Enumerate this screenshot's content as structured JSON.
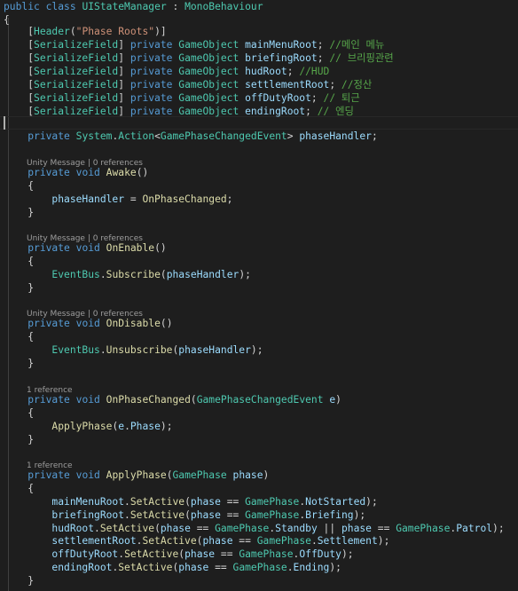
{
  "lines": [
    [
      [
        "kw",
        "public"
      ],
      [
        "pl",
        " "
      ],
      [
        "kw",
        "class"
      ],
      [
        "pl",
        " "
      ],
      [
        "ty",
        "UIStateManager"
      ],
      [
        "pl",
        " : "
      ],
      [
        "ty",
        "MonoBehaviour"
      ]
    ],
    [
      [
        "pl",
        "{"
      ]
    ],
    [
      [
        "pl",
        "    ["
      ],
      [
        "ty",
        "Header"
      ],
      [
        "pl",
        "("
      ],
      [
        "str",
        "\"Phase Roots\""
      ],
      [
        "pl",
        ")]"
      ]
    ],
    [
      [
        "pl",
        "    ["
      ],
      [
        "ty",
        "SerializeField"
      ],
      [
        "pl",
        "] "
      ],
      [
        "kw",
        "private"
      ],
      [
        "pl",
        " "
      ],
      [
        "ty",
        "GameObject"
      ],
      [
        "pl",
        " "
      ],
      [
        "vr",
        "mainMenuRoot"
      ],
      [
        "pl",
        "; "
      ],
      [
        "cm",
        "//메인 메뉴"
      ]
    ],
    [
      [
        "pl",
        "    ["
      ],
      [
        "ty",
        "SerializeField"
      ],
      [
        "pl",
        "] "
      ],
      [
        "kw",
        "private"
      ],
      [
        "pl",
        " "
      ],
      [
        "ty",
        "GameObject"
      ],
      [
        "pl",
        " "
      ],
      [
        "vr",
        "briefingRoot"
      ],
      [
        "pl",
        "; "
      ],
      [
        "cm",
        "// 브리핑관련"
      ]
    ],
    [
      [
        "pl",
        "    ["
      ],
      [
        "ty",
        "SerializeField"
      ],
      [
        "pl",
        "] "
      ],
      [
        "kw",
        "private"
      ],
      [
        "pl",
        " "
      ],
      [
        "ty",
        "GameObject"
      ],
      [
        "pl",
        " "
      ],
      [
        "vr",
        "hudRoot"
      ],
      [
        "pl",
        "; "
      ],
      [
        "cm",
        "//HUD"
      ]
    ],
    [
      [
        "pl",
        "    ["
      ],
      [
        "ty",
        "SerializeField"
      ],
      [
        "pl",
        "] "
      ],
      [
        "kw",
        "private"
      ],
      [
        "pl",
        " "
      ],
      [
        "ty",
        "GameObject"
      ],
      [
        "pl",
        " "
      ],
      [
        "vr",
        "settlementRoot"
      ],
      [
        "pl",
        "; "
      ],
      [
        "cm",
        "//정산"
      ]
    ],
    [
      [
        "pl",
        "    ["
      ],
      [
        "ty",
        "SerializeField"
      ],
      [
        "pl",
        "] "
      ],
      [
        "kw",
        "private"
      ],
      [
        "pl",
        " "
      ],
      [
        "ty",
        "GameObject"
      ],
      [
        "pl",
        " "
      ],
      [
        "vr",
        "offDutyRoot"
      ],
      [
        "pl",
        "; "
      ],
      [
        "cm",
        "// 퇴근"
      ]
    ],
    [
      [
        "pl",
        "    ["
      ],
      [
        "ty",
        "SerializeField"
      ],
      [
        "pl",
        "] "
      ],
      [
        "kw",
        "private"
      ],
      [
        "pl",
        " "
      ],
      [
        "ty",
        "GameObject"
      ],
      [
        "pl",
        " "
      ],
      [
        "vr",
        "endingRoot"
      ],
      [
        "pl",
        "; "
      ],
      [
        "cm",
        "// 엔딩"
      ]
    ],
    [],
    [
      [
        "pl",
        "    "
      ],
      [
        "kw",
        "private"
      ],
      [
        "pl",
        " "
      ],
      [
        "ty",
        "System"
      ],
      [
        "pl",
        "."
      ],
      [
        "ty",
        "Action"
      ],
      [
        "pl",
        "<"
      ],
      [
        "ty",
        "GamePhaseChangedEvent"
      ],
      [
        "pl",
        "> "
      ],
      [
        "vr",
        "phaseHandler"
      ],
      [
        "pl",
        ";"
      ]
    ],
    [],
    [
      [
        "pl",
        "    "
      ],
      [
        "kw",
        "private"
      ],
      [
        "pl",
        " "
      ],
      [
        "kw",
        "void"
      ],
      [
        "pl",
        " "
      ],
      [
        "fn",
        "Awake"
      ],
      [
        "pl",
        "()"
      ]
    ],
    [
      [
        "pl",
        "    {"
      ]
    ],
    [
      [
        "pl",
        "        "
      ],
      [
        "vr",
        "phaseHandler"
      ],
      [
        "pl",
        " = "
      ],
      [
        "fn",
        "OnPhaseChanged"
      ],
      [
        "pl",
        ";"
      ]
    ],
    [
      [
        "pl",
        "    }"
      ]
    ],
    [],
    [
      [
        "pl",
        "    "
      ],
      [
        "kw",
        "private"
      ],
      [
        "pl",
        " "
      ],
      [
        "kw",
        "void"
      ],
      [
        "pl",
        " "
      ],
      [
        "fn",
        "OnEnable"
      ],
      [
        "pl",
        "()"
      ]
    ],
    [
      [
        "pl",
        "    {"
      ]
    ],
    [
      [
        "pl",
        "        "
      ],
      [
        "ty",
        "EventBus"
      ],
      [
        "pl",
        "."
      ],
      [
        "fn",
        "Subscribe"
      ],
      [
        "pl",
        "("
      ],
      [
        "vr",
        "phaseHandler"
      ],
      [
        "pl",
        ");"
      ]
    ],
    [
      [
        "pl",
        "    }"
      ]
    ],
    [],
    [
      [
        "pl",
        "    "
      ],
      [
        "kw",
        "private"
      ],
      [
        "pl",
        " "
      ],
      [
        "kw",
        "void"
      ],
      [
        "pl",
        " "
      ],
      [
        "fn",
        "OnDisable"
      ],
      [
        "pl",
        "()"
      ]
    ],
    [
      [
        "pl",
        "    {"
      ]
    ],
    [
      [
        "pl",
        "        "
      ],
      [
        "ty",
        "EventBus"
      ],
      [
        "pl",
        "."
      ],
      [
        "fn",
        "Unsubscribe"
      ],
      [
        "pl",
        "("
      ],
      [
        "vr",
        "phaseHandler"
      ],
      [
        "pl",
        ");"
      ]
    ],
    [
      [
        "pl",
        "    }"
      ]
    ],
    [],
    [
      [
        "pl",
        "    "
      ],
      [
        "kw",
        "private"
      ],
      [
        "pl",
        " "
      ],
      [
        "kw",
        "void"
      ],
      [
        "pl",
        " "
      ],
      [
        "fn",
        "OnPhaseChanged"
      ],
      [
        "pl",
        "("
      ],
      [
        "ty",
        "GamePhaseChangedEvent"
      ],
      [
        "pl",
        " "
      ],
      [
        "vr",
        "e"
      ],
      [
        "pl",
        ")"
      ]
    ],
    [
      [
        "pl",
        "    {"
      ]
    ],
    [
      [
        "pl",
        "        "
      ],
      [
        "fn",
        "ApplyPhase"
      ],
      [
        "pl",
        "("
      ],
      [
        "vr",
        "e"
      ],
      [
        "pl",
        "."
      ],
      [
        "vr",
        "Phase"
      ],
      [
        "pl",
        ");"
      ]
    ],
    [
      [
        "pl",
        "    }"
      ]
    ],
    [],
    [
      [
        "pl",
        "    "
      ],
      [
        "kw",
        "private"
      ],
      [
        "pl",
        " "
      ],
      [
        "kw",
        "void"
      ],
      [
        "pl",
        " "
      ],
      [
        "fn",
        "ApplyPhase"
      ],
      [
        "pl",
        "("
      ],
      [
        "ty",
        "GamePhase"
      ],
      [
        "pl",
        " "
      ],
      [
        "vr",
        "phase"
      ],
      [
        "pl",
        ")"
      ]
    ],
    [
      [
        "pl",
        "    {"
      ]
    ],
    [
      [
        "pl",
        "        "
      ],
      [
        "vr",
        "mainMenuRoot"
      ],
      [
        "pl",
        "."
      ],
      [
        "fn",
        "SetActive"
      ],
      [
        "pl",
        "("
      ],
      [
        "vr",
        "phase"
      ],
      [
        "pl",
        " == "
      ],
      [
        "ty",
        "GamePhase"
      ],
      [
        "pl",
        "."
      ],
      [
        "vr",
        "NotStarted"
      ],
      [
        "pl",
        ");"
      ]
    ],
    [
      [
        "pl",
        "        "
      ],
      [
        "vr",
        "briefingRoot"
      ],
      [
        "pl",
        "."
      ],
      [
        "fn",
        "SetActive"
      ],
      [
        "pl",
        "("
      ],
      [
        "vr",
        "phase"
      ],
      [
        "pl",
        " == "
      ],
      [
        "ty",
        "GamePhase"
      ],
      [
        "pl",
        "."
      ],
      [
        "vr",
        "Briefing"
      ],
      [
        "pl",
        ");"
      ]
    ],
    [
      [
        "pl",
        "        "
      ],
      [
        "vr",
        "hudRoot"
      ],
      [
        "pl",
        "."
      ],
      [
        "fn",
        "SetActive"
      ],
      [
        "pl",
        "("
      ],
      [
        "vr",
        "phase"
      ],
      [
        "pl",
        " == "
      ],
      [
        "ty",
        "GamePhase"
      ],
      [
        "pl",
        "."
      ],
      [
        "vr",
        "Standby"
      ],
      [
        "pl",
        " || "
      ],
      [
        "vr",
        "phase"
      ],
      [
        "pl",
        " == "
      ],
      [
        "ty",
        "GamePhase"
      ],
      [
        "pl",
        "."
      ],
      [
        "vr",
        "Patrol"
      ],
      [
        "pl",
        ");"
      ]
    ],
    [
      [
        "pl",
        "        "
      ],
      [
        "vr",
        "settlementRoot"
      ],
      [
        "pl",
        "."
      ],
      [
        "fn",
        "SetActive"
      ],
      [
        "pl",
        "("
      ],
      [
        "vr",
        "phase"
      ],
      [
        "pl",
        " == "
      ],
      [
        "ty",
        "GamePhase"
      ],
      [
        "pl",
        "."
      ],
      [
        "vr",
        "Settlement"
      ],
      [
        "pl",
        ");"
      ]
    ],
    [
      [
        "pl",
        "        "
      ],
      [
        "vr",
        "offDutyRoot"
      ],
      [
        "pl",
        "."
      ],
      [
        "fn",
        "SetActive"
      ],
      [
        "pl",
        "("
      ],
      [
        "vr",
        "phase"
      ],
      [
        "pl",
        " == "
      ],
      [
        "ty",
        "GamePhase"
      ],
      [
        "pl",
        "."
      ],
      [
        "vr",
        "OffDuty"
      ],
      [
        "pl",
        ");"
      ]
    ],
    [
      [
        "pl",
        "        "
      ],
      [
        "vr",
        "endingRoot"
      ],
      [
        "pl",
        "."
      ],
      [
        "fn",
        "SetActive"
      ],
      [
        "pl",
        "("
      ],
      [
        "vr",
        "phase"
      ],
      [
        "pl",
        " == "
      ],
      [
        "ty",
        "GamePhase"
      ],
      [
        "pl",
        "."
      ],
      [
        "vr",
        "Ending"
      ],
      [
        "pl",
        ");"
      ]
    ],
    [
      [
        "pl",
        "    }"
      ]
    ]
  ],
  "codelens": {
    "awake": "Unity Message | 0 references",
    "on_enable": "Unity Message | 0 references",
    "on_disable": "Unity Message | 0 references",
    "on_phase_changed": "1 reference",
    "apply_phase": "1 reference"
  },
  "colors": {
    "background": "#1e1e1e",
    "keyword": "#569cd6",
    "type": "#4ec9b0",
    "method": "#dcdcaa",
    "variable": "#9cdcfe",
    "string": "#ce9178",
    "comment": "#57a64a",
    "plain": "#d4d4d4",
    "codelens": "#9d9d9d"
  }
}
